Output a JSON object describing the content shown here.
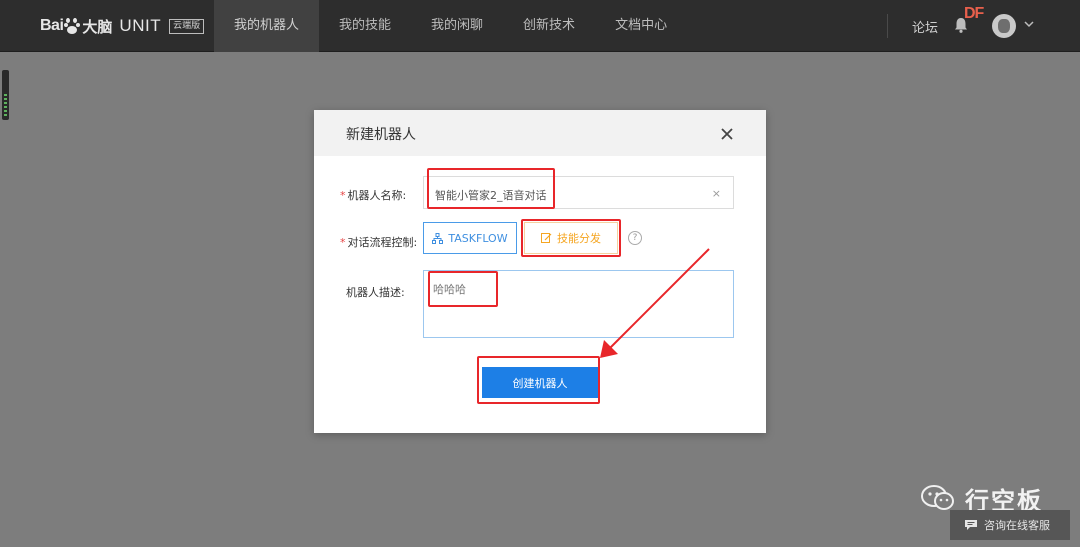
{
  "header": {
    "logo_bai": "Bai",
    "logo_dana": "大脑",
    "logo_unit": "UNIT",
    "logo_badge": "云端版",
    "nav": [
      {
        "label": "我的机器人",
        "active": true
      },
      {
        "label": "我的技能",
        "active": false
      },
      {
        "label": "我的闲聊",
        "active": false
      },
      {
        "label": "创新技术",
        "active": false
      },
      {
        "label": "文档中心",
        "active": false
      }
    ],
    "forum": "论坛",
    "df_mark": "DF"
  },
  "modal": {
    "title": "新建机器人",
    "required_mark": "*",
    "name_label": "机器人名称:",
    "name_value": "智能小管家2_语音对话",
    "clear_symbol": "×",
    "flow_label": "对话流程控制:",
    "taskflow_label": "TASKFLOW",
    "skill_label": "技能分发",
    "help_symbol": "?",
    "desc_label": "机器人描述:",
    "desc_value": "哈哈哈",
    "create_label": "创建机器人"
  },
  "footer": {
    "brand": "行空板",
    "chat_label": "咨询在线客服"
  },
  "colors": {
    "annotation": "#e8262a",
    "primary": "#1d7fe6",
    "skill": "#f5a623"
  }
}
